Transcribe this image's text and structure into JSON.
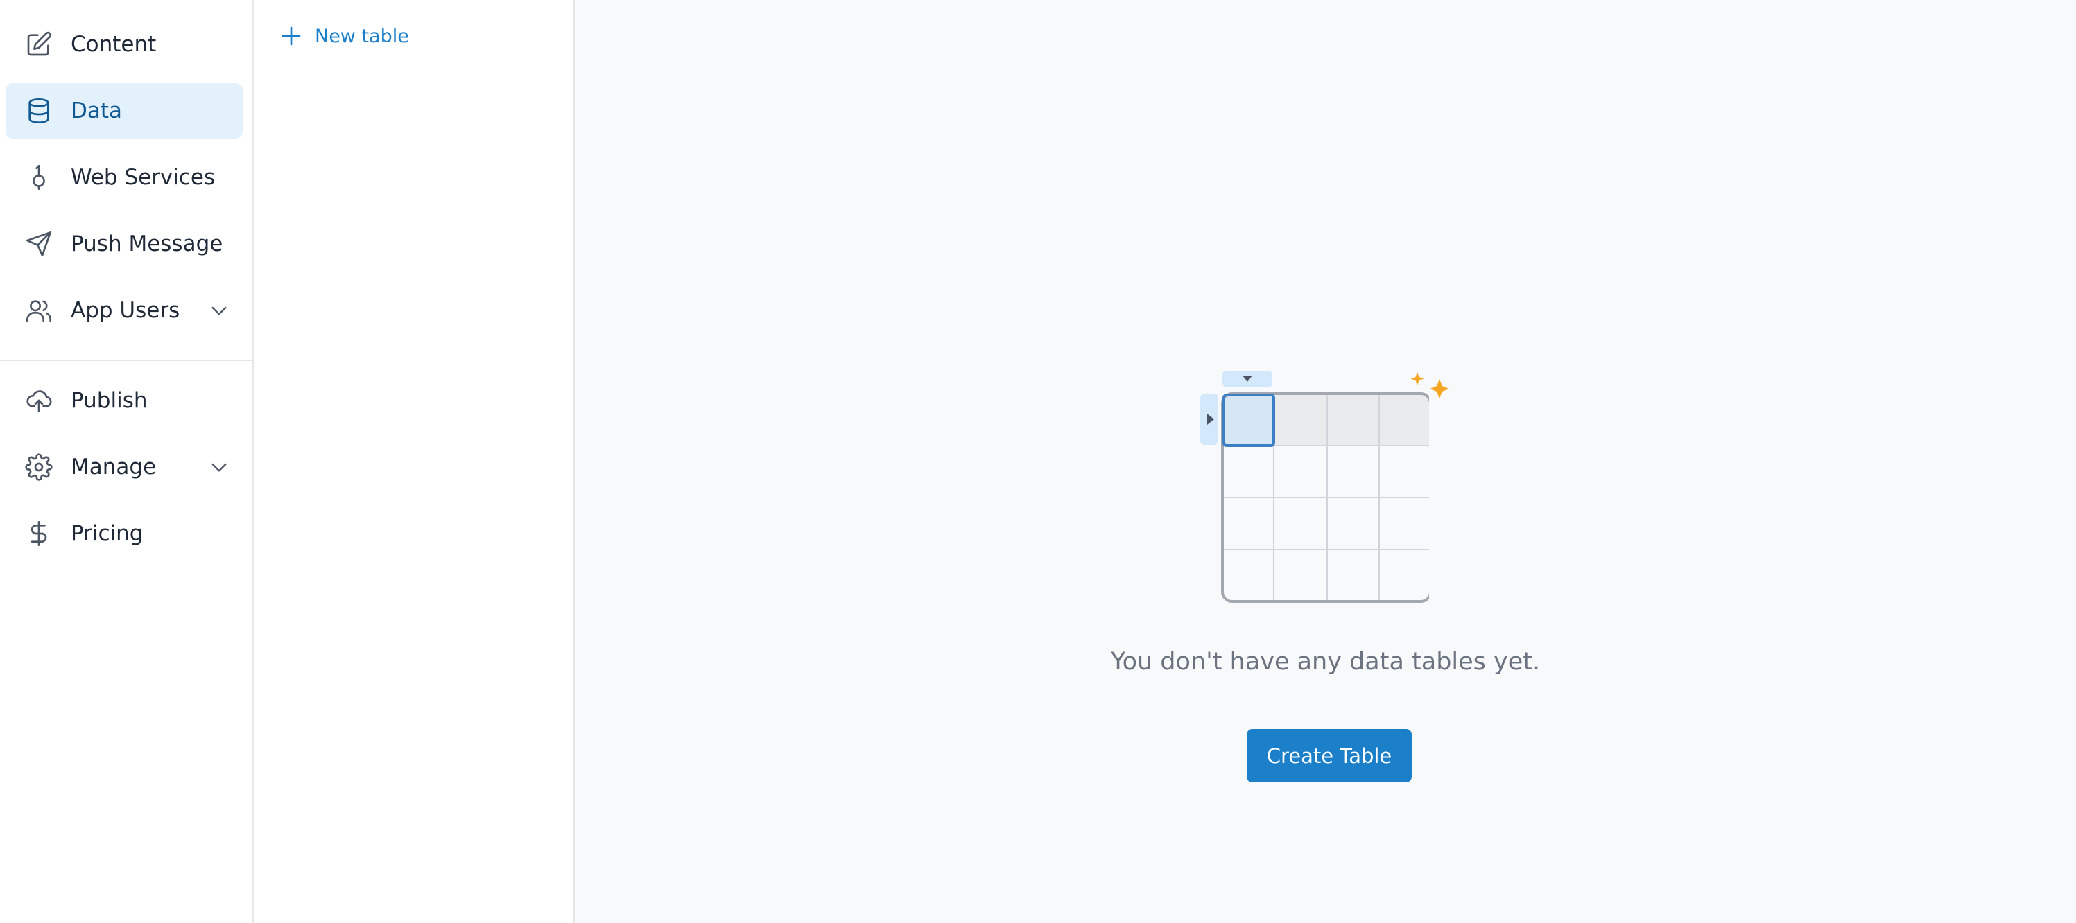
{
  "sidebar": {
    "items": [
      {
        "label": "Content",
        "icon": "edit-icon"
      },
      {
        "label": "Data",
        "icon": "database-icon",
        "active": true
      },
      {
        "label": "Web Services",
        "icon": "web-services-icon"
      },
      {
        "label": "Push Message",
        "icon": "send-icon"
      },
      {
        "label": "App Users",
        "icon": "users-icon",
        "expandable": true
      }
    ],
    "secondary_items": [
      {
        "label": "Publish",
        "icon": "cloud-upload-icon"
      },
      {
        "label": "Manage",
        "icon": "gear-icon",
        "expandable": true
      },
      {
        "label": "Pricing",
        "icon": "dollar-icon"
      }
    ]
  },
  "list_panel": {
    "new_table_label": "New table"
  },
  "main": {
    "empty_message": "You don't have any data tables yet.",
    "create_button_label": "Create Table"
  },
  "colors": {
    "accent": "#1b7fc9",
    "active_bg": "#e3f1fd",
    "active_text": "#0f5a94",
    "sparkle": "#f5a623"
  }
}
